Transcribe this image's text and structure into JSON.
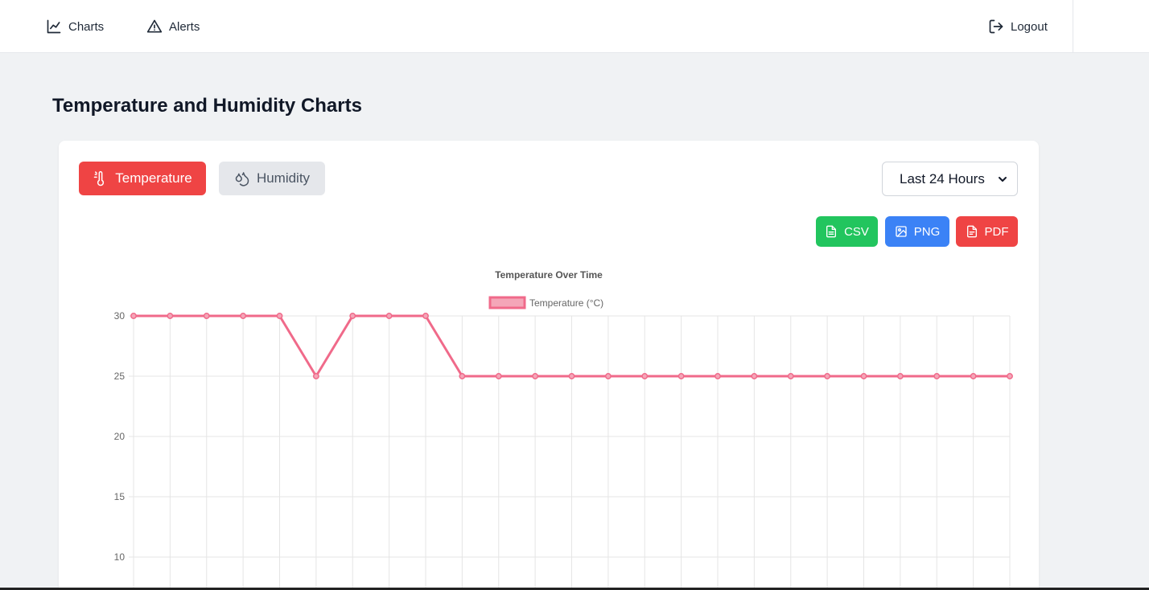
{
  "nav": {
    "charts_label": "Charts",
    "alerts_label": "Alerts",
    "logout_label": "Logout"
  },
  "page": {
    "title": "Temperature and Humidity Charts"
  },
  "tabs": [
    {
      "label": "Temperature",
      "icon": "thermometer-icon",
      "active": true
    },
    {
      "label": "Humidity",
      "icon": "droplets-icon",
      "active": false
    }
  ],
  "range_select": {
    "value": "Last 24 Hours"
  },
  "export": {
    "csv_label": "CSV",
    "png_label": "PNG",
    "pdf_label": "PDF"
  },
  "colors": {
    "accent_red": "#ef4444",
    "csv_green": "#22c55e",
    "png_blue": "#3b82f6",
    "series_line": "#f06a8a"
  },
  "chart_data": {
    "type": "line",
    "title": "Temperature Over Time",
    "legend_position": "top",
    "grid": true,
    "series": [
      {
        "name": "Temperature (°C)",
        "values": [
          30,
          30,
          30,
          30,
          30,
          25,
          30,
          30,
          30,
          25,
          25,
          25,
          25,
          25,
          25,
          25,
          25,
          25,
          25,
          25,
          25,
          25,
          25,
          25,
          25
        ]
      }
    ],
    "y_ticks": [
      30,
      25,
      20,
      15,
      10
    ],
    "ylim": [
      7.5,
      30
    ]
  }
}
